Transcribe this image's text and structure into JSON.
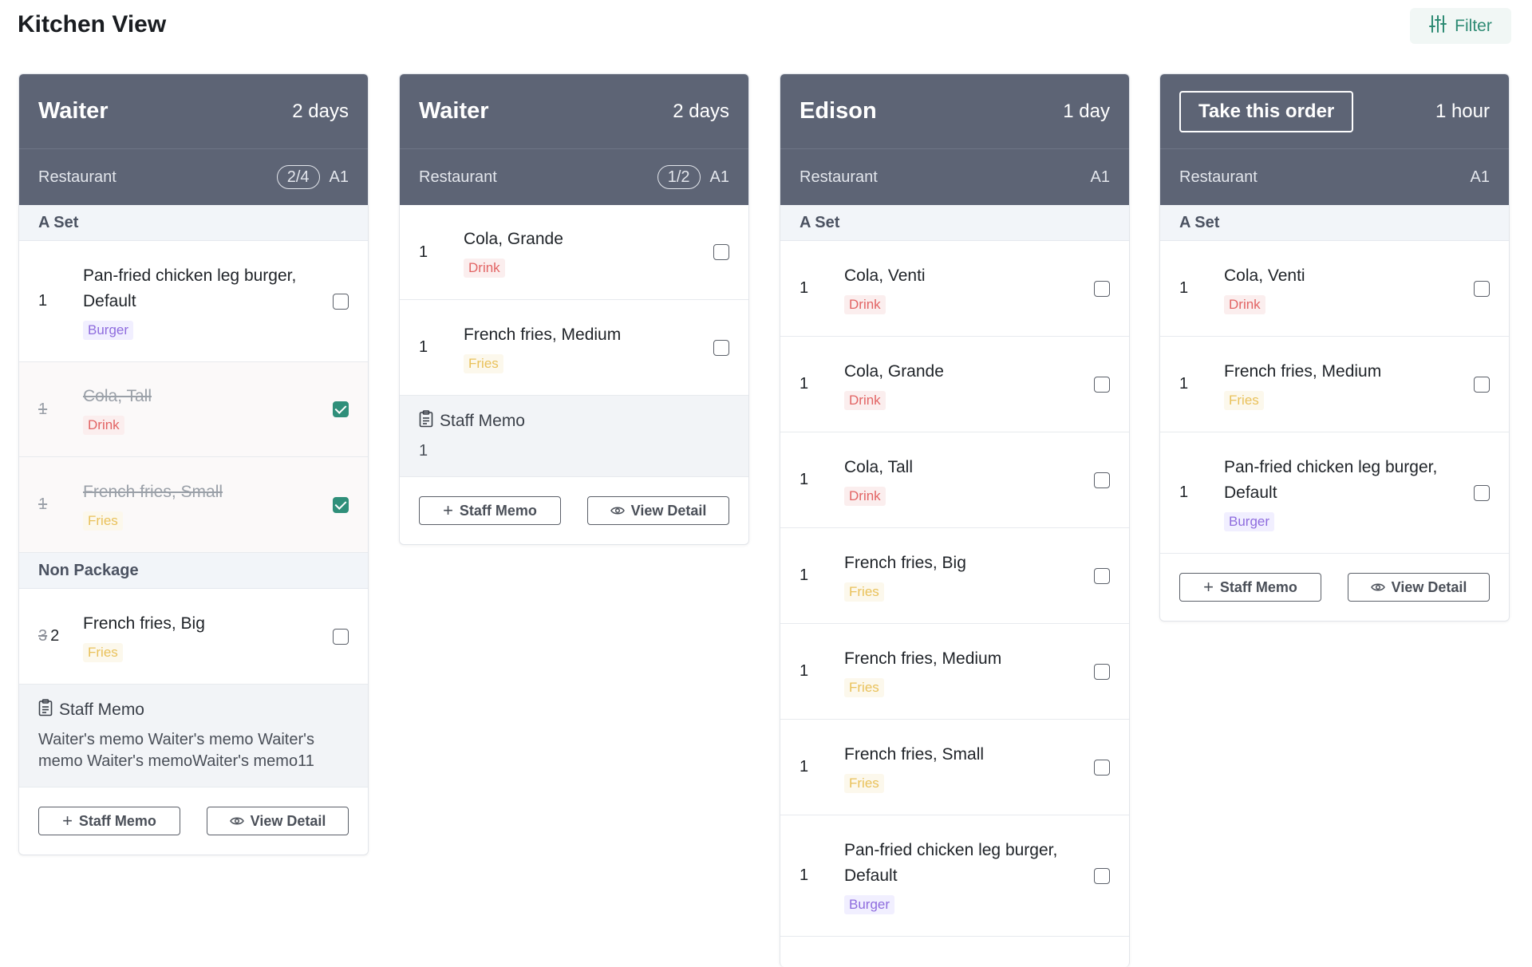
{
  "header": {
    "title": "Kitchen View",
    "filter_label": "Filter"
  },
  "colors": {
    "card_header": "#5d6475",
    "accent": "#2f8f7a",
    "drink_tag": "#e26464",
    "fries_tag": "#e9c15a",
    "burger_tag": "#8e6cde"
  },
  "cards": [
    {
      "waiter": "Waiter",
      "elapsed": "2 days",
      "location": "Restaurant",
      "progress": "2/4",
      "table": "A1",
      "groups": [
        {
          "name": "A Set",
          "items": [
            {
              "qty": "1",
              "name": "Pan-fried chicken leg burger, Default",
              "tag": "Burger",
              "checked": false
            },
            {
              "qty": "1",
              "name": "Cola, Tall",
              "tag": "Drink",
              "checked": true
            },
            {
              "qty": "1",
              "name": "French fries, Small",
              "tag": "Fries",
              "checked": true
            }
          ]
        },
        {
          "name": "Non Package",
          "items": [
            {
              "qty_old": "3",
              "qty": "2",
              "name": "French fries, Big",
              "tag": "Fries",
              "checked": false
            }
          ]
        }
      ],
      "memo_title": "Staff Memo",
      "memo_text": "Waiter's memo Waiter's memo Waiter's memo Waiter's memoWaiter's memo11",
      "staff_memo_btn": "Staff Memo",
      "view_detail_btn": "View Detail"
    },
    {
      "waiter": "Waiter",
      "elapsed": "2 days",
      "location": "Restaurant",
      "progress": "1/2",
      "table": "A1",
      "items": [
        {
          "qty": "1",
          "name": "Cola, Grande",
          "tag": "Drink",
          "checked": false
        },
        {
          "qty": "1",
          "name": "French fries, Medium",
          "tag": "Fries",
          "checked": false
        }
      ],
      "memo_title": "Staff Memo",
      "memo_text": "1",
      "staff_memo_btn": "Staff Memo",
      "view_detail_btn": "View Detail"
    },
    {
      "waiter": "Edison",
      "elapsed": "1 day",
      "location": "Restaurant",
      "table": "A1",
      "group_name": "A Set",
      "items": [
        {
          "qty": "1",
          "name": "Cola, Venti",
          "tag": "Drink",
          "checked": false
        },
        {
          "qty": "1",
          "name": "Cola, Grande",
          "tag": "Drink",
          "checked": false
        },
        {
          "qty": "1",
          "name": "Cola, Tall",
          "tag": "Drink",
          "checked": false
        },
        {
          "qty": "1",
          "name": "French fries, Big",
          "tag": "Fries",
          "checked": false
        },
        {
          "qty": "1",
          "name": "French fries, Medium",
          "tag": "Fries",
          "checked": false
        },
        {
          "qty": "1",
          "name": "French fries, Small",
          "tag": "Fries",
          "checked": false
        },
        {
          "qty": "1",
          "name": "Pan-fried chicken leg burger, Default",
          "tag": "Burger",
          "checked": false
        }
      ]
    },
    {
      "take_order_label": "Take this order",
      "elapsed": "1 hour",
      "location": "Restaurant",
      "table": "A1",
      "group_name": "A Set",
      "items": [
        {
          "qty": "1",
          "name": "Cola, Venti",
          "tag": "Drink",
          "checked": false
        },
        {
          "qty": "1",
          "name": "French fries, Medium",
          "tag": "Fries",
          "checked": false
        },
        {
          "qty": "1",
          "name": "Pan-fried chicken leg burger, Default",
          "tag": "Burger",
          "checked": false
        }
      ],
      "staff_memo_btn": "Staff Memo",
      "view_detail_btn": "View Detail"
    }
  ]
}
